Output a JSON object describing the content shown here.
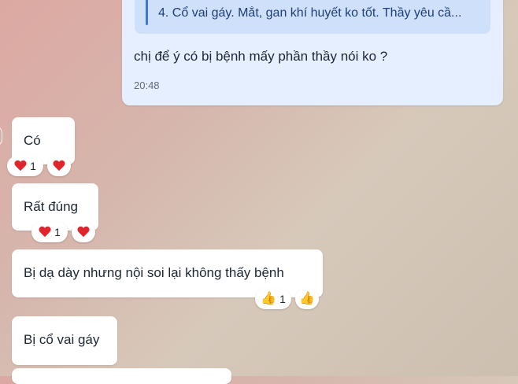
{
  "sent_message": {
    "quote_text": "4. Cổ vai gáy. Mắt, gan khí huyết ko tốt. Thầy yêu cầ...",
    "text": "chị để ý có bị bệnh mấy phần thầy nói ko ?",
    "time": "20:48"
  },
  "incoming": [
    {
      "text": "Có",
      "reactions": [
        {
          "emoji": "heart-icon",
          "count": "1"
        },
        {
          "emoji": "heart-icon",
          "count": ""
        }
      ]
    },
    {
      "text": "Rất đúng",
      "reactions": [
        {
          "emoji": "heart-icon",
          "count": "1"
        },
        {
          "emoji": "heart-icon",
          "count": ""
        }
      ]
    },
    {
      "text": "Bị dạ dày nhưng nội soi lại không thấy bệnh",
      "reactions": [
        {
          "emoji": "thumbs-up-icon",
          "count": "1"
        },
        {
          "emoji": "thumbs-up-icon",
          "count": ""
        }
      ]
    },
    {
      "text": "Bị cổ vai gáy",
      "reactions": []
    }
  ],
  "colors": {
    "sent_bubble": "#e6efff",
    "quote_bg": "#cfe0fb",
    "quote_bar": "#3a78d8",
    "heart": "#e0242c",
    "thumb": "#f3b61f"
  }
}
